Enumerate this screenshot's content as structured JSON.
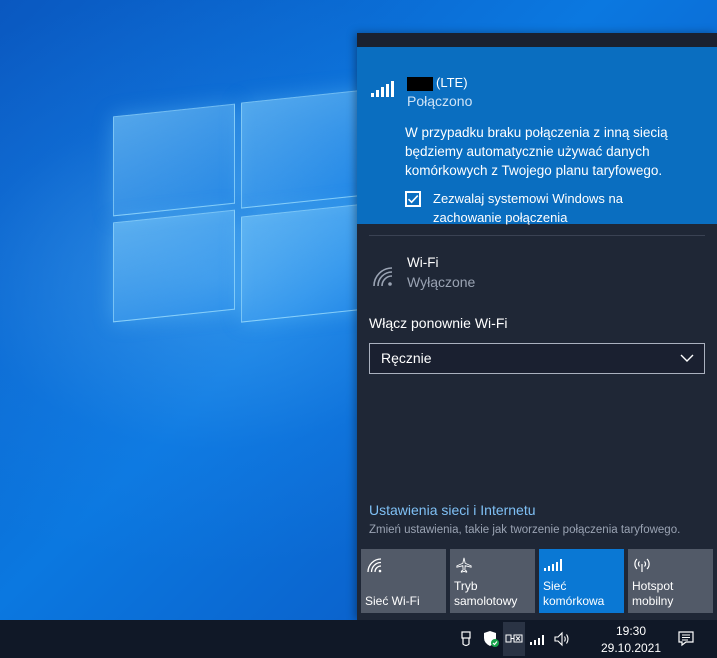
{
  "cellular": {
    "name_suffix": "(LTE)",
    "status": "Połączono",
    "description": "W przypadku braku połączenia z inną siecią będziemy automatycznie używać danych komórkowych z Twojego planu taryfowego.",
    "allow_label": "Zezwalaj systemowi Windows na zachowanie połączenia",
    "allow_checked": true
  },
  "wifi": {
    "title": "Wi-Fi",
    "status": "Wyłączone",
    "reenable_label": "Włącz ponownie Wi-Fi",
    "reenable_value": "Ręcznie"
  },
  "settings": {
    "link": "Ustawienia sieci i Internetu",
    "description": "Zmień ustawienia, takie jak tworzenie połączenia taryfowego."
  },
  "tiles": [
    {
      "label": "Sieć Wi-Fi",
      "icon": "wifi-icon",
      "active": false
    },
    {
      "label": "Tryb samolotowy",
      "icon": "airplane-icon",
      "active": false
    },
    {
      "label": "Sieć komórkowa",
      "icon": "cellular-icon",
      "active": true
    },
    {
      "label": "Hotspot mobilny",
      "icon": "hotspot-icon",
      "active": false
    }
  ],
  "taskbar": {
    "time": "19:30",
    "date": "29.10.2021"
  },
  "colors": {
    "accent": "#0a78d4",
    "panel_bg": "#1f2736",
    "cell_panel_bg": "#0a6ec0",
    "link": "#7fc0f5"
  }
}
